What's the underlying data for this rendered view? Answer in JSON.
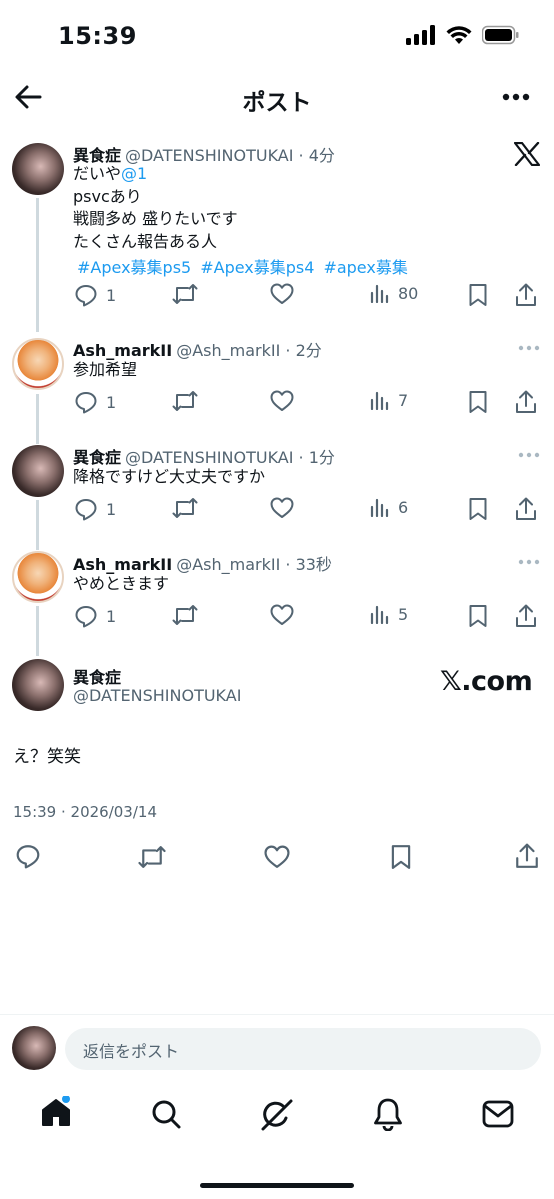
{
  "status_bar": {
    "time": "15:39"
  },
  "header": {
    "title": "ポスト"
  },
  "thread": [
    {
      "name": "異食症",
      "handle": "@DATENSHINOTUKAI",
      "time": "4分",
      "lines": [
        "だいや",
        "psvcあり",
        "戦闘多め 盛りたいです",
        "たくさん報告ある人"
      ],
      "mention": "@1",
      "hashtags": [
        "#Apex募集ps5",
        "#Apex募集ps4",
        "#apex募集"
      ],
      "replies": "1",
      "views": "80"
    },
    {
      "name": "Ash_markII",
      "handle": "@Ash_markII",
      "time": "2分",
      "text": "参加希望",
      "replies": "1",
      "views": "7"
    },
    {
      "name": "異食症",
      "handle": "@DATENSHINOTUKAI",
      "time": "1分",
      "text": "降格ですけど大丈夫ですか",
      "replies": "1",
      "views": "6"
    },
    {
      "name": "Ash_markII",
      "handle": "@Ash_markII",
      "time": "33秒",
      "text": "やめときます",
      "replies": "1",
      "views": "5"
    }
  ],
  "main_post": {
    "name": "異食症",
    "handle": "@DATENSHINOTUKAI",
    "brand": "𝕏.com",
    "text": "え？笑笑",
    "timestamp": "15:39 · 2026/03/14"
  },
  "reply_box": {
    "placeholder": "返信をポスト"
  },
  "colors": {
    "link": "#1d9bf0",
    "secondary_text": "#536471",
    "thread_line": "#cfd9de",
    "notification_dot": "#1d9bf0"
  },
  "icons": [
    "back-arrow-icon",
    "more-icon",
    "x-logo-icon",
    "reply-icon",
    "repost-icon",
    "like-icon",
    "views-icon",
    "bookmark-icon",
    "share-icon",
    "home-icon",
    "search-icon",
    "grok-icon",
    "notifications-icon",
    "messages-icon"
  ]
}
